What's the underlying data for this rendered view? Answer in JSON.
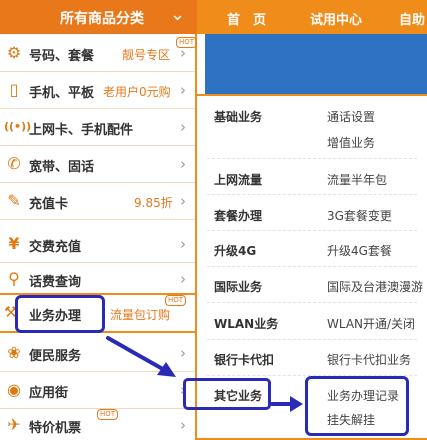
{
  "header": {
    "category_title": "所有商品分类",
    "nav": [
      "首　页",
      "试用中心",
      "自助"
    ]
  },
  "categories": [
    {
      "icon": "gear-icon",
      "label": "号码、套餐",
      "sub": "靓号专区",
      "hot": true
    },
    {
      "icon": "phone-icon",
      "label": "手机、平板",
      "sub": "老用户0元购",
      "hot": false
    },
    {
      "icon": "wifi-icon",
      "label": "上网卡、手机配件",
      "sub": "",
      "hot": false
    },
    {
      "icon": "handset-icon",
      "label": "宽带、固话",
      "sub": "",
      "hot": false
    },
    {
      "icon": "card-icon",
      "label": "充值卡",
      "sub": "9.85折",
      "hot": false
    },
    {
      "icon": "yuan-icon",
      "label": "交费充值",
      "sub": "",
      "hot": false
    },
    {
      "icon": "search-icon",
      "label": "话费查询",
      "sub": "",
      "hot": false
    },
    {
      "icon": "wrench-icon",
      "label": "业务办理",
      "sub": "流量包订购",
      "hot": true
    },
    {
      "icon": "service-icon",
      "label": "便民服务",
      "sub": "",
      "hot": false
    },
    {
      "icon": "android-icon",
      "label": "应用街",
      "sub": "",
      "hot": false
    },
    {
      "icon": "plane-icon",
      "label": "特价机票",
      "sub": "",
      "hot": true
    }
  ],
  "hot_label": "HOT",
  "submenu": [
    {
      "name": "基础业务",
      "links": [
        "通话设置",
        "增值业务"
      ]
    },
    {
      "name": "上网流量",
      "links": [
        "流量半年包"
      ]
    },
    {
      "name": "套餐办理",
      "links": [
        "3G套餐变更"
      ]
    },
    {
      "name": "升级4G",
      "links": [
        "升级4G套餐"
      ]
    },
    {
      "name": "国际业务",
      "links": [
        "国际及台港澳漫游"
      ]
    },
    {
      "name": "WLAN业务",
      "links": [
        "WLAN开通/关闭"
      ]
    },
    {
      "name": "银行卡代扣",
      "links": [
        "银行卡代扣业务"
      ]
    },
    {
      "name": "其它业务",
      "links": [
        "业务办理记录",
        "挂失解挂"
      ]
    }
  ],
  "colors": {
    "brand_orange": "#f08c1a",
    "annotation_blue": "#2a2ab8",
    "banner_blue": "#2f72c4"
  }
}
